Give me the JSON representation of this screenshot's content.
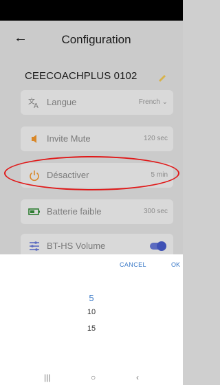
{
  "header": {
    "title": "Configuration"
  },
  "device": {
    "name": "CEECOACHPLUS 0102"
  },
  "settings": [
    {
      "label": "Langue",
      "value": "French",
      "icon": "translate-icon"
    },
    {
      "label": "Invite Mute",
      "value": "120 sec",
      "icon": "speaker-mute-icon"
    },
    {
      "label": "Désactiver",
      "value": "5 min",
      "icon": "power-icon"
    },
    {
      "label": "Batterie faible",
      "value": "300 sec",
      "icon": "battery-icon"
    },
    {
      "label": "BT-HS Volume",
      "icon": "sliders-icon"
    }
  ],
  "picker": {
    "cancel": "CANCEL",
    "ok": "OK",
    "options": [
      "5",
      "10",
      "15"
    ],
    "selected": "5"
  },
  "colors": {
    "accent": "#3a79c7",
    "highlight": "#e01919",
    "toggle": "#3f51b5"
  }
}
